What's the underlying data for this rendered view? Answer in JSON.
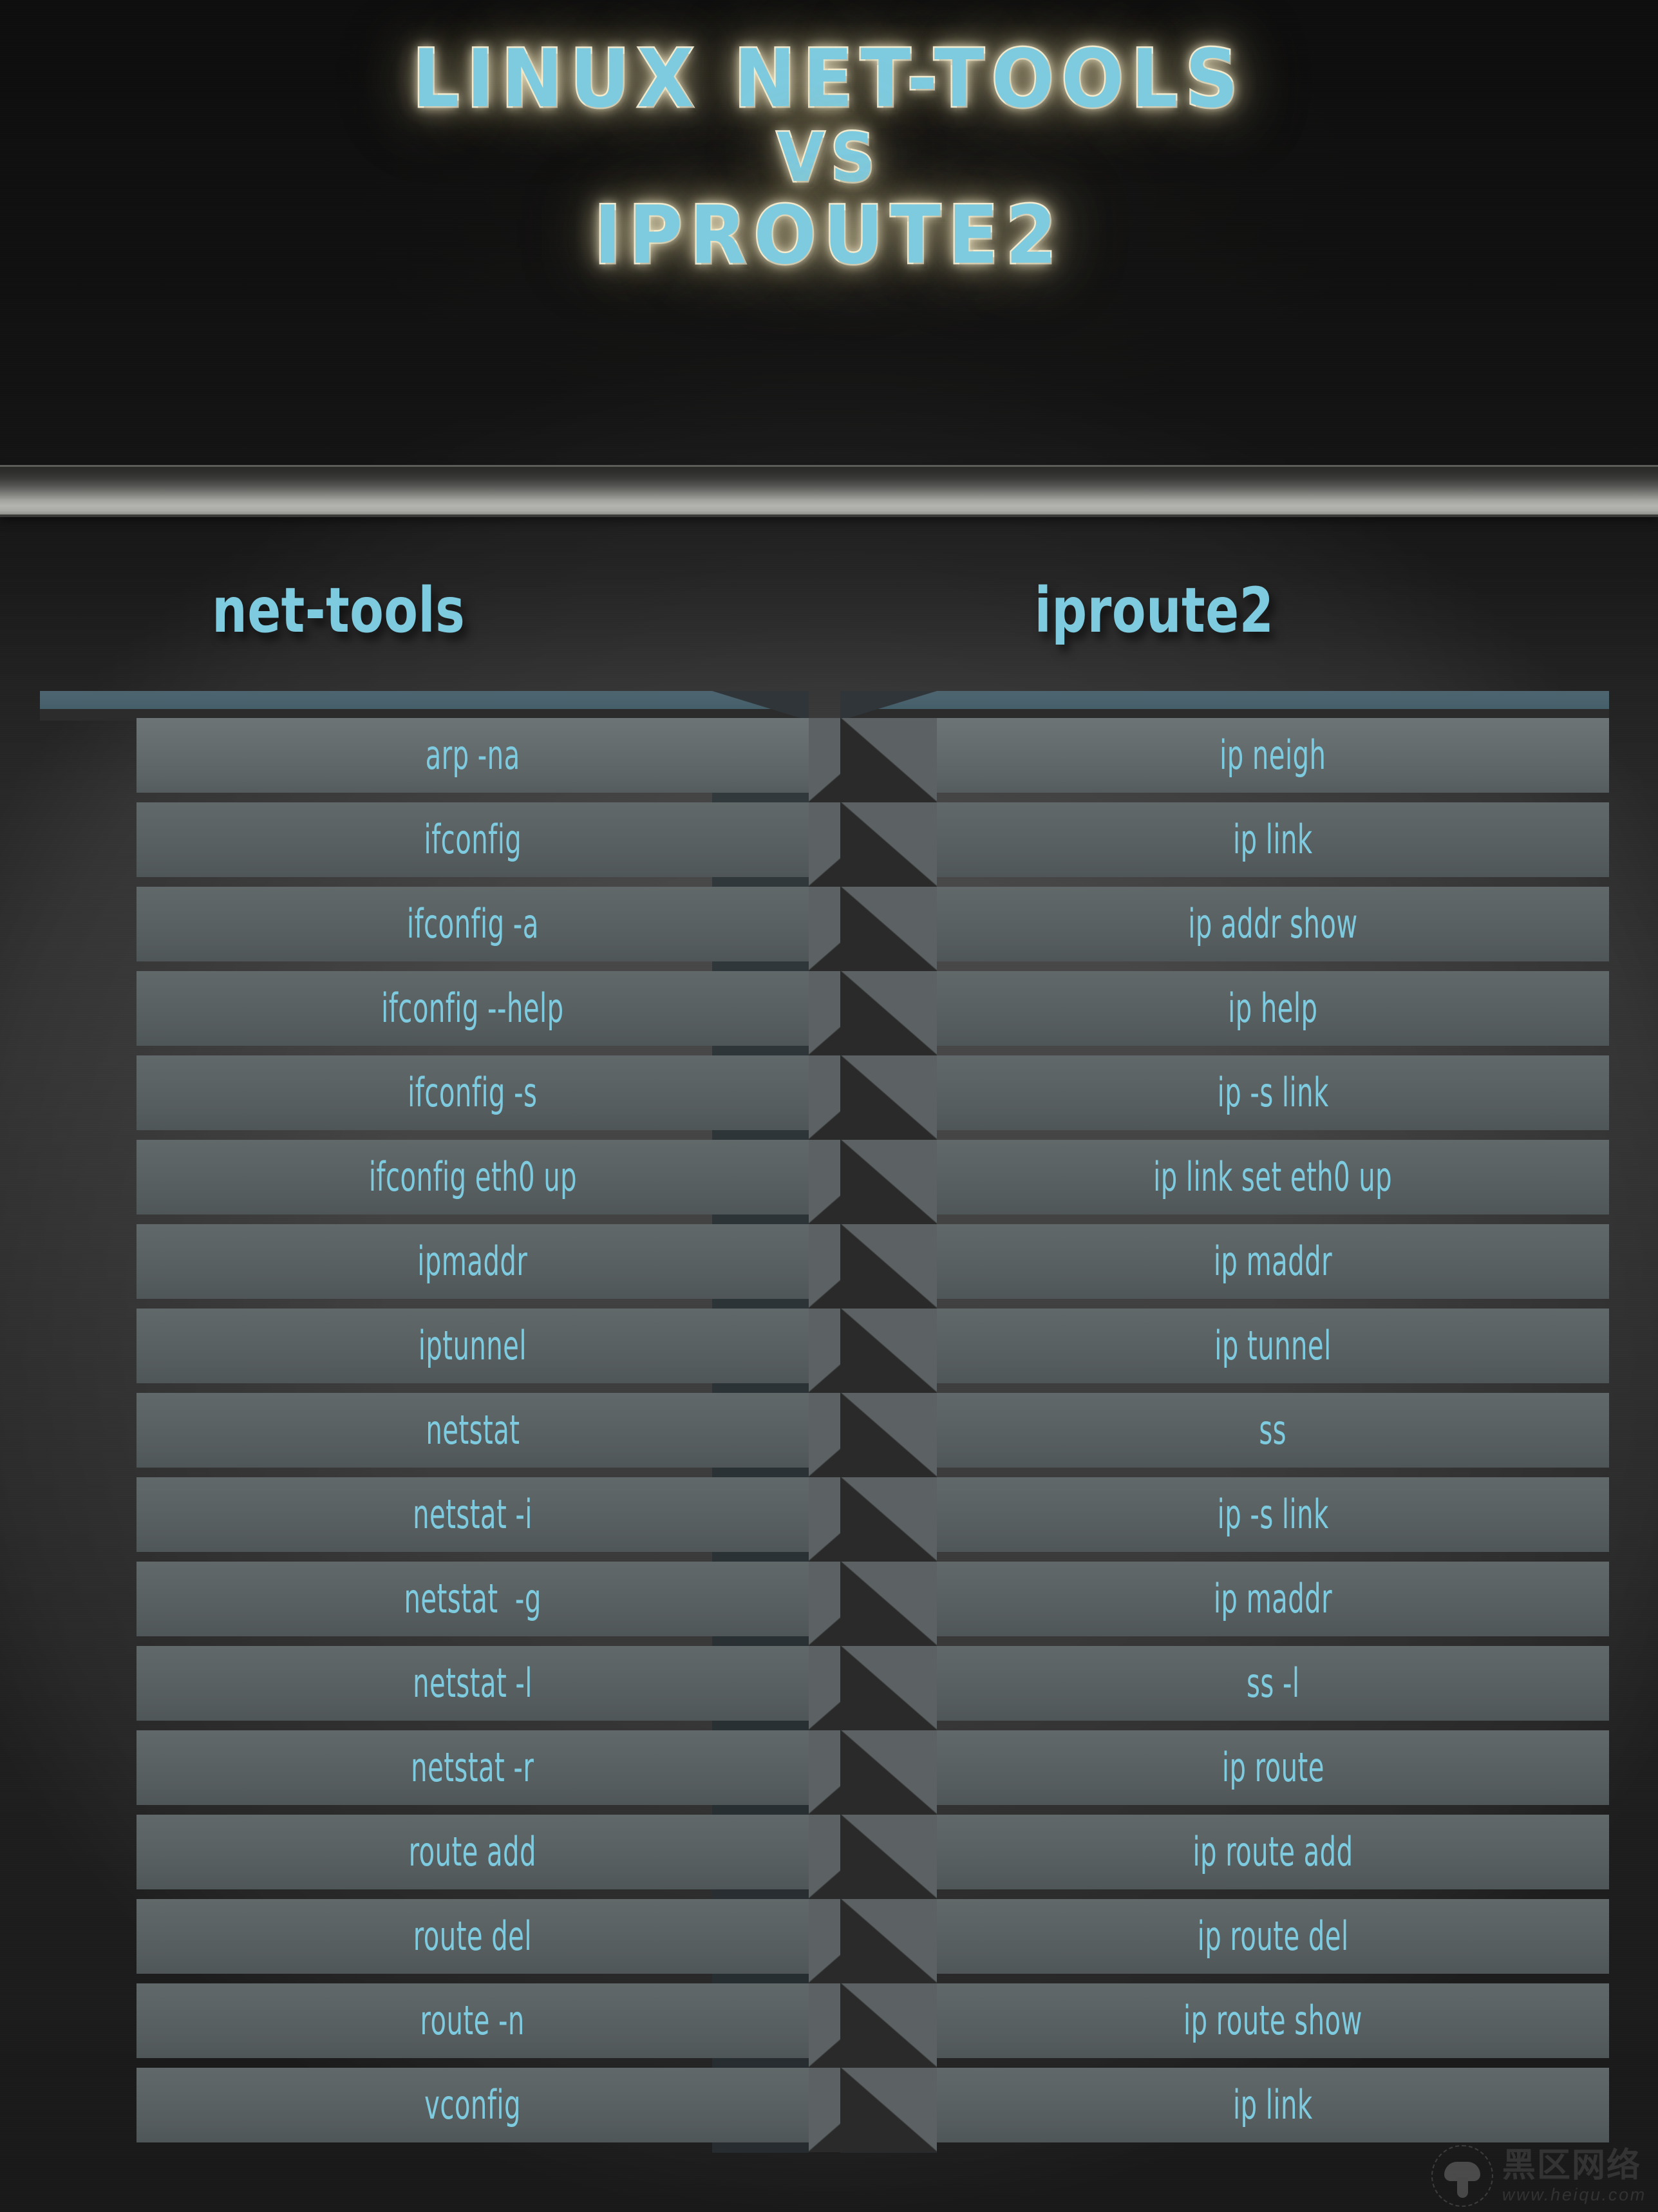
{
  "title": {
    "line1": "LINUX NET-TOOLS",
    "line2": "VS",
    "line3": "IPROUTE2"
  },
  "colors": {
    "accent_cyan": "#7ecbe0",
    "cap_steel_blue": "#46606b",
    "row_face": "#5b6365",
    "background_dark": "#1e1e1e",
    "title_glow": "#fff6d6"
  },
  "columns": {
    "left": {
      "header": "net-tools",
      "rows": [
        "arp -na",
        "ifconfig",
        "ifconfig -a",
        "ifconfig --help",
        "ifconfig -s",
        "ifconfig eth0 up",
        "ipmaddr",
        "iptunnel",
        "netstat",
        "netstat -i",
        "netstat  -g",
        "netstat -l",
        "netstat -r",
        "route add",
        "route del",
        "route -n",
        "vconfig"
      ]
    },
    "right": {
      "header": "iproute2",
      "rows": [
        "ip neigh",
        "ip link",
        "ip addr show",
        "ip help",
        "ip -s link",
        "ip link set eth0 up",
        "ip maddr",
        "ip tunnel",
        "ss",
        "ip -s link",
        "ip maddr",
        "ss -l",
        "ip route",
        "ip route add",
        "ip route del",
        "ip route show",
        "ip link"
      ]
    }
  },
  "watermark": {
    "brand_cn": "黑区网络",
    "url": "www.heiqu.com"
  }
}
